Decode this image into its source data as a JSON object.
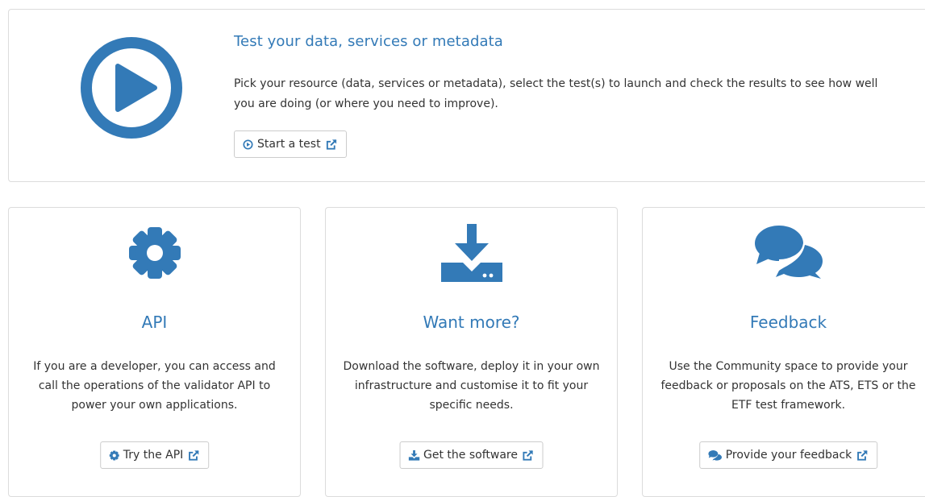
{
  "hero": {
    "title": "Test your data, services or metadata",
    "description": "Pick your resource (data, services or metadata), select the test(s) to launch and check the results to see how well you are doing (or where you need to improve).",
    "button_label": "Start a test",
    "icon": "play-circle-icon"
  },
  "cards": [
    {
      "title": "API",
      "description": "If you are a developer, you can access and call the operations of the validator API to power your own applications.",
      "button_label": "Try the API",
      "icon": "gear-icon"
    },
    {
      "title": "Want more?",
      "description": "Download the software, deploy it in your own infrastructure and customise it to fit your specific needs.",
      "button_label": "Get the software",
      "icon": "download-icon"
    },
    {
      "title": "Feedback",
      "description": "Use the Community space to provide your feedback or proposals on the ATS, ETS or the ETF test framework.",
      "button_label": "Provide your feedback",
      "icon": "comments-icon"
    }
  ],
  "colors": {
    "accent": "#337ab7",
    "text": "#333333",
    "border": "#dcdcdc"
  }
}
